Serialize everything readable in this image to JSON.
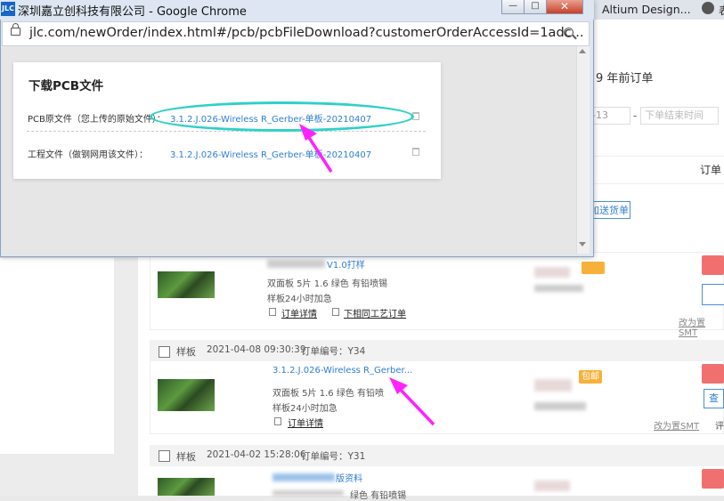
{
  "popup": {
    "title": "深圳嘉立创科技有限公司 - Google Chrome",
    "icon_label": "JLC",
    "url": "jlc.com/newOrder/index.html#/pcb/pcbFileDownload?customerOrderAccessId=1adc...",
    "window_buttons": {
      "minimize": "—",
      "maximize": "□",
      "close": "✕"
    }
  },
  "dialog": {
    "title": "下载PCB文件",
    "rows": [
      {
        "label": "PCB原文件（您上传的原始文件）：",
        "file": "3.1.2.J.026-Wireless R_Gerber-单板-20210407"
      },
      {
        "label": "工程文件（做钢网用该文件）：",
        "file": "3.1.2.J.026-Wireless R_Gerber-单板-20210407"
      }
    ]
  },
  "background": {
    "tab_text": "Altium Design...",
    "tab_extra": "表",
    "page_title": "9 年前订单",
    "date_start": "-13",
    "date_dash": "-",
    "date_end_placeholder": "下单结束时间",
    "header_right": "订单",
    "send_button": "加送货单",
    "orders": [
      {
        "file": "",
        "file_suffix": "V1.0打样",
        "spec": "双面板  5片  1.6  绿色  有铅喷锡",
        "urgency": "样板24小时加急",
        "links": [
          "订单详情",
          "下相同工艺订单"
        ],
        "change": "改为置SMT"
      },
      {
        "type": "样板",
        "date": "2021-04-08 09:30:39",
        "order_no": "订单编号：Y34",
        "file": "3.1.2.J.026-Wireless R_Gerber...",
        "spec": "双面板  5片  1.6  绿色  有铅喷",
        "urgency": "样板24小时加急",
        "links": [
          "订单详情"
        ],
        "tag": "包邮",
        "change": "改为置SMT",
        "action": "查",
        "extra": "评"
      },
      {
        "type": "样板",
        "date": "2021-04-02 15:28:06",
        "order_no": "订单编号：Y31",
        "file": "版资料",
        "spec": "绿色  有铅喷锡"
      }
    ]
  }
}
